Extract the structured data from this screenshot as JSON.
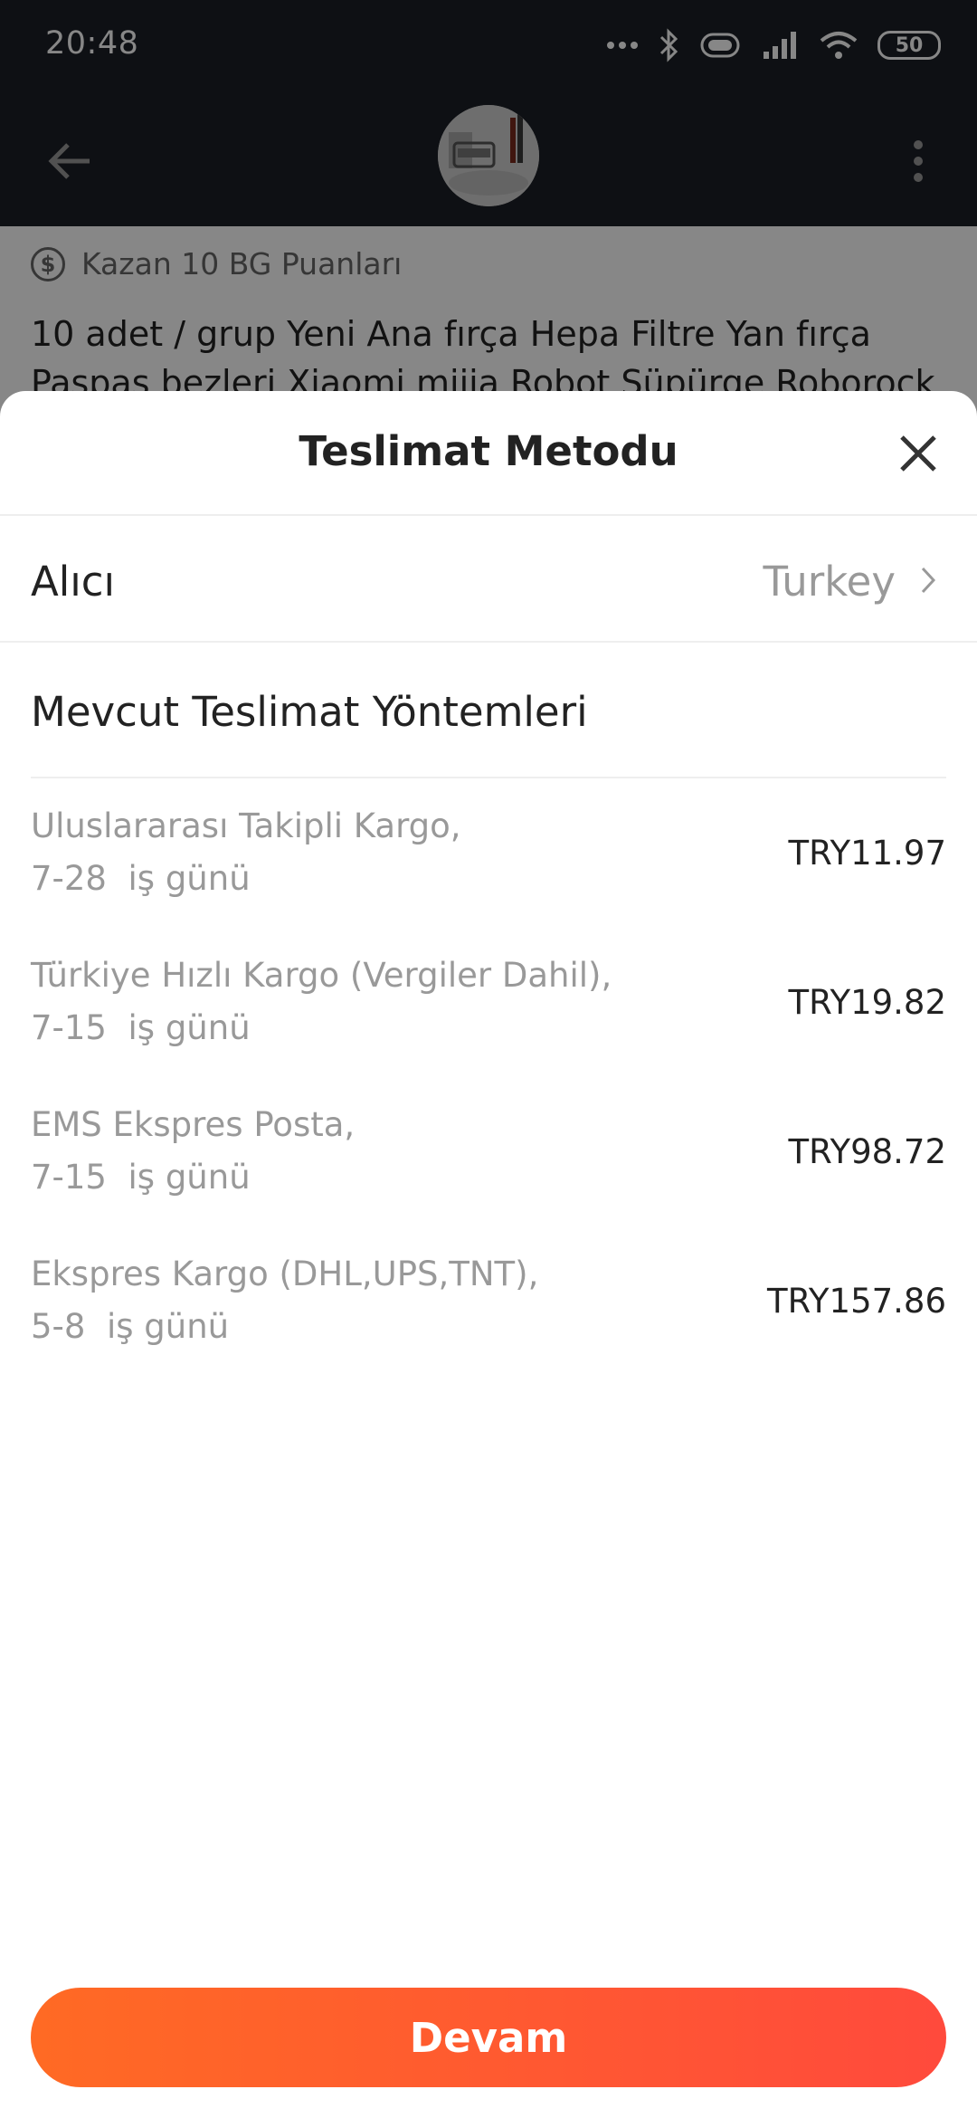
{
  "status_bar": {
    "time": "20:48",
    "battery": "50",
    "icons": [
      "more-dots-icon",
      "bluetooth-icon",
      "battery-saver-icon",
      "signal-icon",
      "wifi-icon",
      "battery-icon"
    ]
  },
  "top_bar": {
    "back_icon": "arrow-left-icon",
    "more_icon": "more-vertical-icon"
  },
  "product": {
    "points_text": "Kazan 10 BG Puanları",
    "title": "10 adet / grup Yeni Ana fırça Hepa Filtre Yan fırça Paspas bezleri Xiaomi mijia Robot Süpürge Roborock"
  },
  "sheet": {
    "title": "Teslimat Metodu",
    "close_icon": "close-icon",
    "recipient_label": "Alıcı",
    "recipient_value": "Turkey",
    "methods_heading": "Mevcut Teslimat Yöntemleri",
    "methods": [
      {
        "name": "Uluslararası Takipli Kargo,",
        "days": "7-28  iş günü",
        "price": "TRY11.97"
      },
      {
        "name": "Türkiye Hızlı Kargo (Vergiler Dahil),",
        "days": "7-15  iş günü",
        "price": "TRY19.82"
      },
      {
        "name": "EMS Ekspres Posta,",
        "days": "7-15  iş günü",
        "price": "TRY98.72"
      },
      {
        "name": "Ekspres Kargo (DHL,UPS,TNT),",
        "days": "5-8  iş günü",
        "price": "TRY157.86"
      }
    ],
    "continue_label": "Devam"
  },
  "colors": {
    "accent_start": "#ff6a24",
    "accent_end": "#ff4a3c",
    "dark_bar": "#1b1f26"
  }
}
